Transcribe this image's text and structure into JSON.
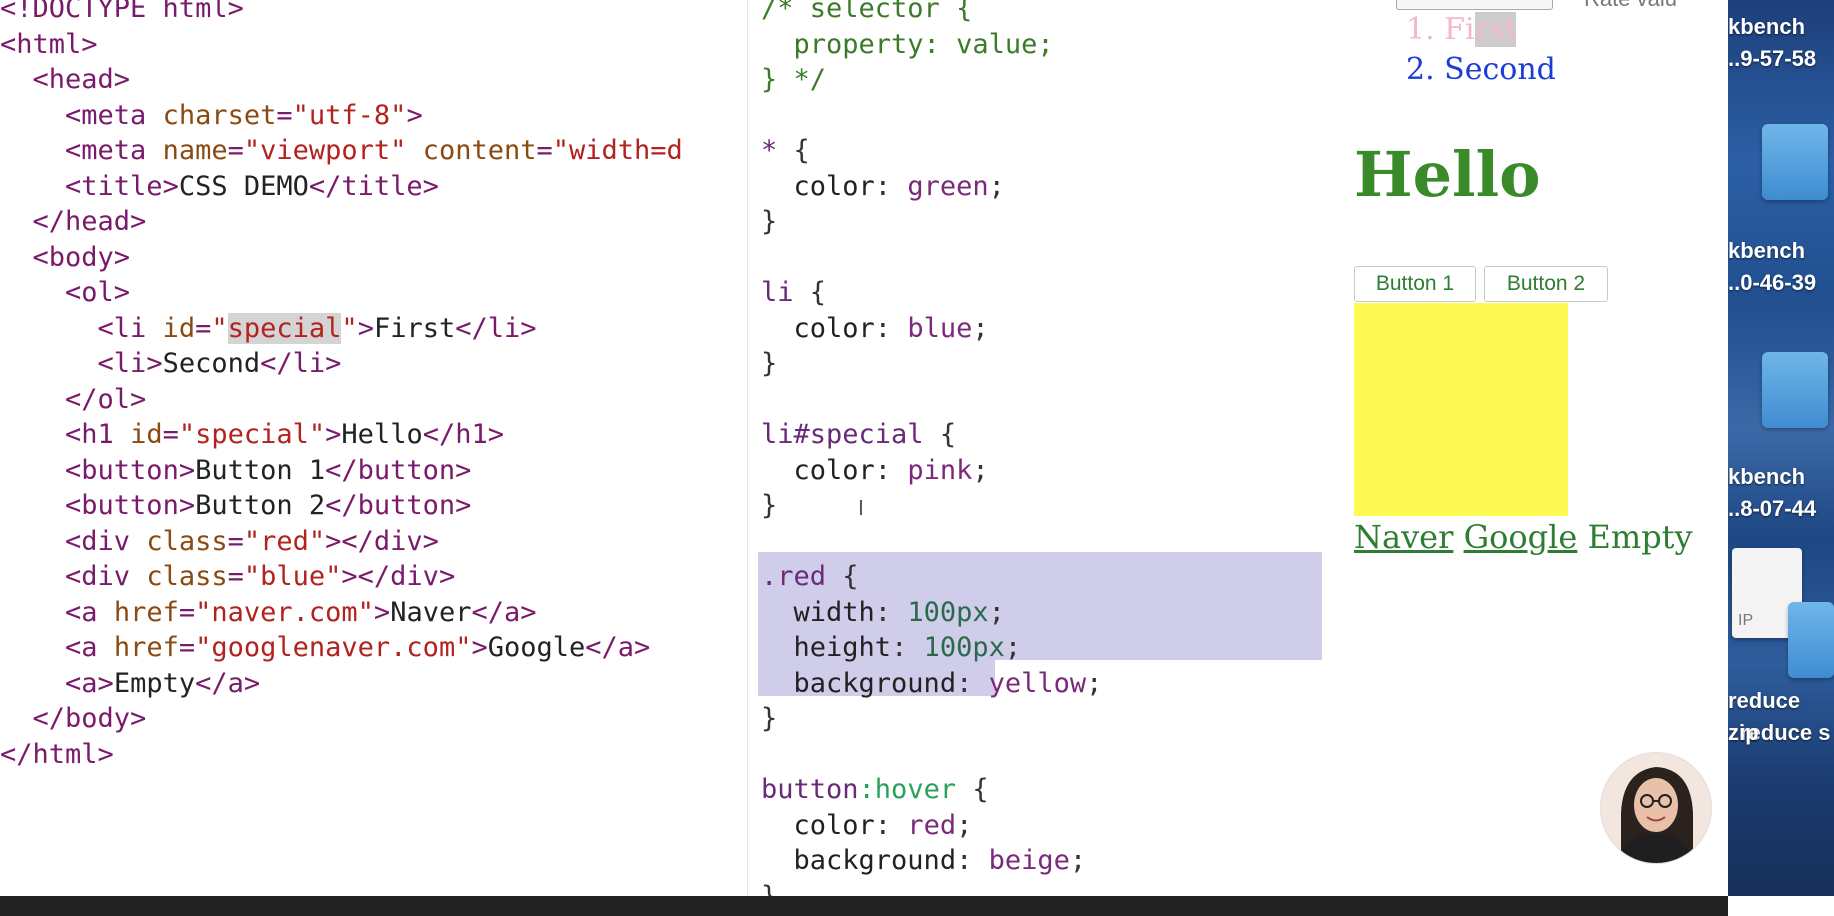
{
  "html_editor": {
    "lines": [
      {
        "indent": "",
        "segments": [
          {
            "t": "tag",
            "v": "<!DOCTYPE html>"
          }
        ]
      },
      {
        "indent": "",
        "segments": [
          {
            "t": "tag",
            "v": "<html>"
          }
        ]
      },
      {
        "indent": "  ",
        "segments": [
          {
            "t": "tag",
            "v": "<head>"
          }
        ]
      },
      {
        "indent": "    ",
        "segments": [
          {
            "t": "tag",
            "v": "<meta "
          },
          {
            "t": "attr",
            "v": "charset"
          },
          {
            "t": "tag",
            "v": "="
          },
          {
            "t": "str",
            "v": "\"utf-8\""
          },
          {
            "t": "tag",
            "v": ">"
          }
        ]
      },
      {
        "indent": "    ",
        "segments": [
          {
            "t": "tag",
            "v": "<meta "
          },
          {
            "t": "attr",
            "v": "name"
          },
          {
            "t": "tag",
            "v": "="
          },
          {
            "t": "str",
            "v": "\"viewport\""
          },
          {
            "t": "tag",
            "v": " "
          },
          {
            "t": "attr",
            "v": "content"
          },
          {
            "t": "tag",
            "v": "="
          },
          {
            "t": "str",
            "v": "\"width=d"
          }
        ]
      },
      {
        "indent": "    ",
        "segments": [
          {
            "t": "tag",
            "v": "<title>"
          },
          {
            "t": "txt",
            "v": "CSS DEMO"
          },
          {
            "t": "tag",
            "v": "</title>"
          }
        ]
      },
      {
        "indent": "  ",
        "segments": [
          {
            "t": "tag",
            "v": "</head>"
          }
        ]
      },
      {
        "indent": "  ",
        "segments": [
          {
            "t": "tag",
            "v": "<body>"
          }
        ]
      },
      {
        "indent": "    ",
        "segments": [
          {
            "t": "tag",
            "v": "<ol>"
          }
        ]
      },
      {
        "indent": "      ",
        "segments": [
          {
            "t": "tag",
            "v": "<li "
          },
          {
            "t": "attr",
            "v": "id"
          },
          {
            "t": "tag",
            "v": "="
          },
          {
            "t": "str",
            "v": "\""
          },
          {
            "t": "strhl",
            "v": "special"
          },
          {
            "t": "str",
            "v": "\""
          },
          {
            "t": "tag",
            "v": ">"
          },
          {
            "t": "txt",
            "v": "First"
          },
          {
            "t": "tag",
            "v": "</li>"
          }
        ]
      },
      {
        "indent": "      ",
        "segments": [
          {
            "t": "tag",
            "v": "<li>"
          },
          {
            "t": "txt",
            "v": "Second"
          },
          {
            "t": "tag",
            "v": "</li>"
          }
        ]
      },
      {
        "indent": "    ",
        "segments": [
          {
            "t": "tag",
            "v": "</ol>"
          }
        ]
      },
      {
        "indent": "    ",
        "segments": [
          {
            "t": "tag",
            "v": "<h1 "
          },
          {
            "t": "attr",
            "v": "id"
          },
          {
            "t": "tag",
            "v": "="
          },
          {
            "t": "str",
            "v": "\"special\""
          },
          {
            "t": "tag",
            "v": ">"
          },
          {
            "t": "txt",
            "v": "Hello"
          },
          {
            "t": "tag",
            "v": "</h1>"
          }
        ]
      },
      {
        "indent": "    ",
        "segments": [
          {
            "t": "tag",
            "v": "<button>"
          },
          {
            "t": "txt",
            "v": "Button 1"
          },
          {
            "t": "tag",
            "v": "</button>"
          }
        ]
      },
      {
        "indent": "    ",
        "segments": [
          {
            "t": "tag",
            "v": "<button>"
          },
          {
            "t": "txt",
            "v": "Button 2"
          },
          {
            "t": "tag",
            "v": "</button>"
          }
        ]
      },
      {
        "indent": "    ",
        "segments": [
          {
            "t": "tag",
            "v": "<div "
          },
          {
            "t": "attr",
            "v": "class"
          },
          {
            "t": "tag",
            "v": "="
          },
          {
            "t": "str",
            "v": "\"red\""
          },
          {
            "t": "tag",
            "v": "></div>"
          }
        ]
      },
      {
        "indent": "    ",
        "segments": [
          {
            "t": "tag",
            "v": "<div "
          },
          {
            "t": "attr",
            "v": "class"
          },
          {
            "t": "tag",
            "v": "="
          },
          {
            "t": "str",
            "v": "\"blue\""
          },
          {
            "t": "tag",
            "v": "></div>"
          }
        ]
      },
      {
        "indent": "    ",
        "segments": [
          {
            "t": "tag",
            "v": "<a "
          },
          {
            "t": "attr",
            "v": "href"
          },
          {
            "t": "tag",
            "v": "="
          },
          {
            "t": "str",
            "v": "\"naver.com\""
          },
          {
            "t": "tag",
            "v": ">"
          },
          {
            "t": "txt",
            "v": "Naver"
          },
          {
            "t": "tag",
            "v": "</a>"
          }
        ]
      },
      {
        "indent": "    ",
        "segments": [
          {
            "t": "tag",
            "v": "<a "
          },
          {
            "t": "attr",
            "v": "href"
          },
          {
            "t": "tag",
            "v": "="
          },
          {
            "t": "str",
            "v": "\"googlenaver.com\""
          },
          {
            "t": "tag",
            "v": ">"
          },
          {
            "t": "txt",
            "v": "Google"
          },
          {
            "t": "tag",
            "v": "</a>"
          }
        ]
      },
      {
        "indent": "    ",
        "segments": [
          {
            "t": "tag",
            "v": "<a>"
          },
          {
            "t": "txt",
            "v": "Empty"
          },
          {
            "t": "tag",
            "v": "</a>"
          }
        ]
      },
      {
        "indent": "  ",
        "segments": [
          {
            "t": "tag",
            "v": "</body>"
          }
        ]
      },
      {
        "indent": "",
        "segments": [
          {
            "t": "tag",
            "v": "</html>"
          }
        ]
      }
    ]
  },
  "css_editor": {
    "lines": [
      {
        "indent": "",
        "segments": [
          {
            "t": "c-comment",
            "v": "/* selector {"
          }
        ]
      },
      {
        "indent": "  ",
        "segments": [
          {
            "t": "c-comment",
            "v": "property: value;"
          }
        ]
      },
      {
        "indent": "",
        "segments": [
          {
            "t": "c-comment",
            "v": "} */"
          }
        ]
      },
      {
        "indent": "",
        "segments": []
      },
      {
        "indent": "",
        "segments": [
          {
            "t": "c-sel",
            "v": "*"
          },
          {
            "t": "c-punct",
            "v": " {"
          }
        ]
      },
      {
        "indent": "  ",
        "segments": [
          {
            "t": "c-prop",
            "v": "color"
          },
          {
            "t": "c-punct",
            "v": ": "
          },
          {
            "t": "c-val",
            "v": "green"
          },
          {
            "t": "c-punct",
            "v": ";"
          }
        ]
      },
      {
        "indent": "",
        "segments": [
          {
            "t": "c-punct",
            "v": "}"
          }
        ]
      },
      {
        "indent": "",
        "segments": []
      },
      {
        "indent": "",
        "segments": [
          {
            "t": "c-sel",
            "v": "li"
          },
          {
            "t": "c-punct",
            "v": " {"
          }
        ]
      },
      {
        "indent": "  ",
        "segments": [
          {
            "t": "c-prop",
            "v": "color"
          },
          {
            "t": "c-punct",
            "v": ": "
          },
          {
            "t": "c-val",
            "v": "blue"
          },
          {
            "t": "c-punct",
            "v": ";"
          }
        ]
      },
      {
        "indent": "",
        "segments": [
          {
            "t": "c-punct",
            "v": "}"
          }
        ]
      },
      {
        "indent": "",
        "segments": []
      },
      {
        "indent": "",
        "segments": [
          {
            "t": "c-sel",
            "v": "li#special"
          },
          {
            "t": "c-punct",
            "v": " {"
          }
        ]
      },
      {
        "indent": "  ",
        "segments": [
          {
            "t": "c-prop",
            "v": "color"
          },
          {
            "t": "c-punct",
            "v": ": "
          },
          {
            "t": "c-val",
            "v": "pink"
          },
          {
            "t": "c-punct",
            "v": ";"
          }
        ]
      },
      {
        "indent": "",
        "segments": [
          {
            "t": "c-punct",
            "v": "}"
          }
        ]
      },
      {
        "indent": "",
        "segments": []
      },
      {
        "indent": "",
        "segments": [
          {
            "t": "c-sel",
            "v": ".red"
          },
          {
            "t": "c-punct",
            "v": " {"
          }
        ]
      },
      {
        "indent": "  ",
        "segments": [
          {
            "t": "c-prop",
            "v": "width"
          },
          {
            "t": "c-punct",
            "v": ": "
          },
          {
            "t": "c-num",
            "v": "100px"
          },
          {
            "t": "c-punct",
            "v": ";"
          }
        ]
      },
      {
        "indent": "  ",
        "segments": [
          {
            "t": "c-prop",
            "v": "height"
          },
          {
            "t": "c-punct",
            "v": ": "
          },
          {
            "t": "c-num",
            "v": "100px"
          },
          {
            "t": "c-punct",
            "v": ";"
          }
        ]
      },
      {
        "indent": "  ",
        "segments": [
          {
            "t": "c-prop",
            "v": "background"
          },
          {
            "t": "c-punct",
            "v": ": "
          },
          {
            "t": "c-val",
            "v": "yellow"
          },
          {
            "t": "c-punct",
            "v": ";"
          }
        ]
      },
      {
        "indent": "",
        "segments": [
          {
            "t": "c-punct",
            "v": "}"
          }
        ]
      },
      {
        "indent": "",
        "segments": []
      },
      {
        "indent": "",
        "segments": [
          {
            "t": "c-sel",
            "v": "button"
          },
          {
            "t": "c-pseudo",
            "v": ":hover"
          },
          {
            "t": "c-punct",
            "v": " {"
          }
        ]
      },
      {
        "indent": "  ",
        "segments": [
          {
            "t": "c-prop",
            "v": "color"
          },
          {
            "t": "c-punct",
            "v": ": "
          },
          {
            "t": "c-val",
            "v": "red"
          },
          {
            "t": "c-punct",
            "v": ";"
          }
        ]
      },
      {
        "indent": "  ",
        "segments": [
          {
            "t": "c-prop",
            "v": "background"
          },
          {
            "t": "c-punct",
            "v": ": "
          },
          {
            "t": "c-val",
            "v": "beige"
          },
          {
            "t": "c-punct",
            "v": ";"
          }
        ]
      },
      {
        "indent": "",
        "segments": [
          {
            "t": "c-punct",
            "v": "}"
          }
        ]
      }
    ]
  },
  "preview": {
    "top_partial_text": "Rate valu",
    "list_items": [
      {
        "number": "1.",
        "label_visible": "Fi",
        "label_highlight": "rst"
      },
      {
        "number": "2.",
        "label": "Second"
      }
    ],
    "heading": "Hello",
    "buttons": [
      "Button 1",
      "Button 2"
    ],
    "links": [
      {
        "label": "Naver",
        "link": true
      },
      {
        "label": "Google",
        "link": true
      },
      {
        "label": "Empty",
        "link": false
      }
    ],
    "colors": {
      "heading": "#3a8a2a",
      "li1": "#f5b8c6",
      "li2": "#1a3cd8",
      "box": "#fdfb53",
      "link": "#2e7d32"
    }
  },
  "desktop": {
    "icons": [
      {
        "label1": "kbench",
        "label2": "..9-57-58"
      },
      {
        "label1": "kbench",
        "label2": "..0-46-39"
      },
      {
        "label1": "kbench",
        "label2": "..8-07-44"
      },
      {
        "label1": "reduce",
        "label2": "zip"
      },
      {
        "label1": "reduce s",
        "label2": ""
      }
    ],
    "zip_badge": "IP"
  }
}
